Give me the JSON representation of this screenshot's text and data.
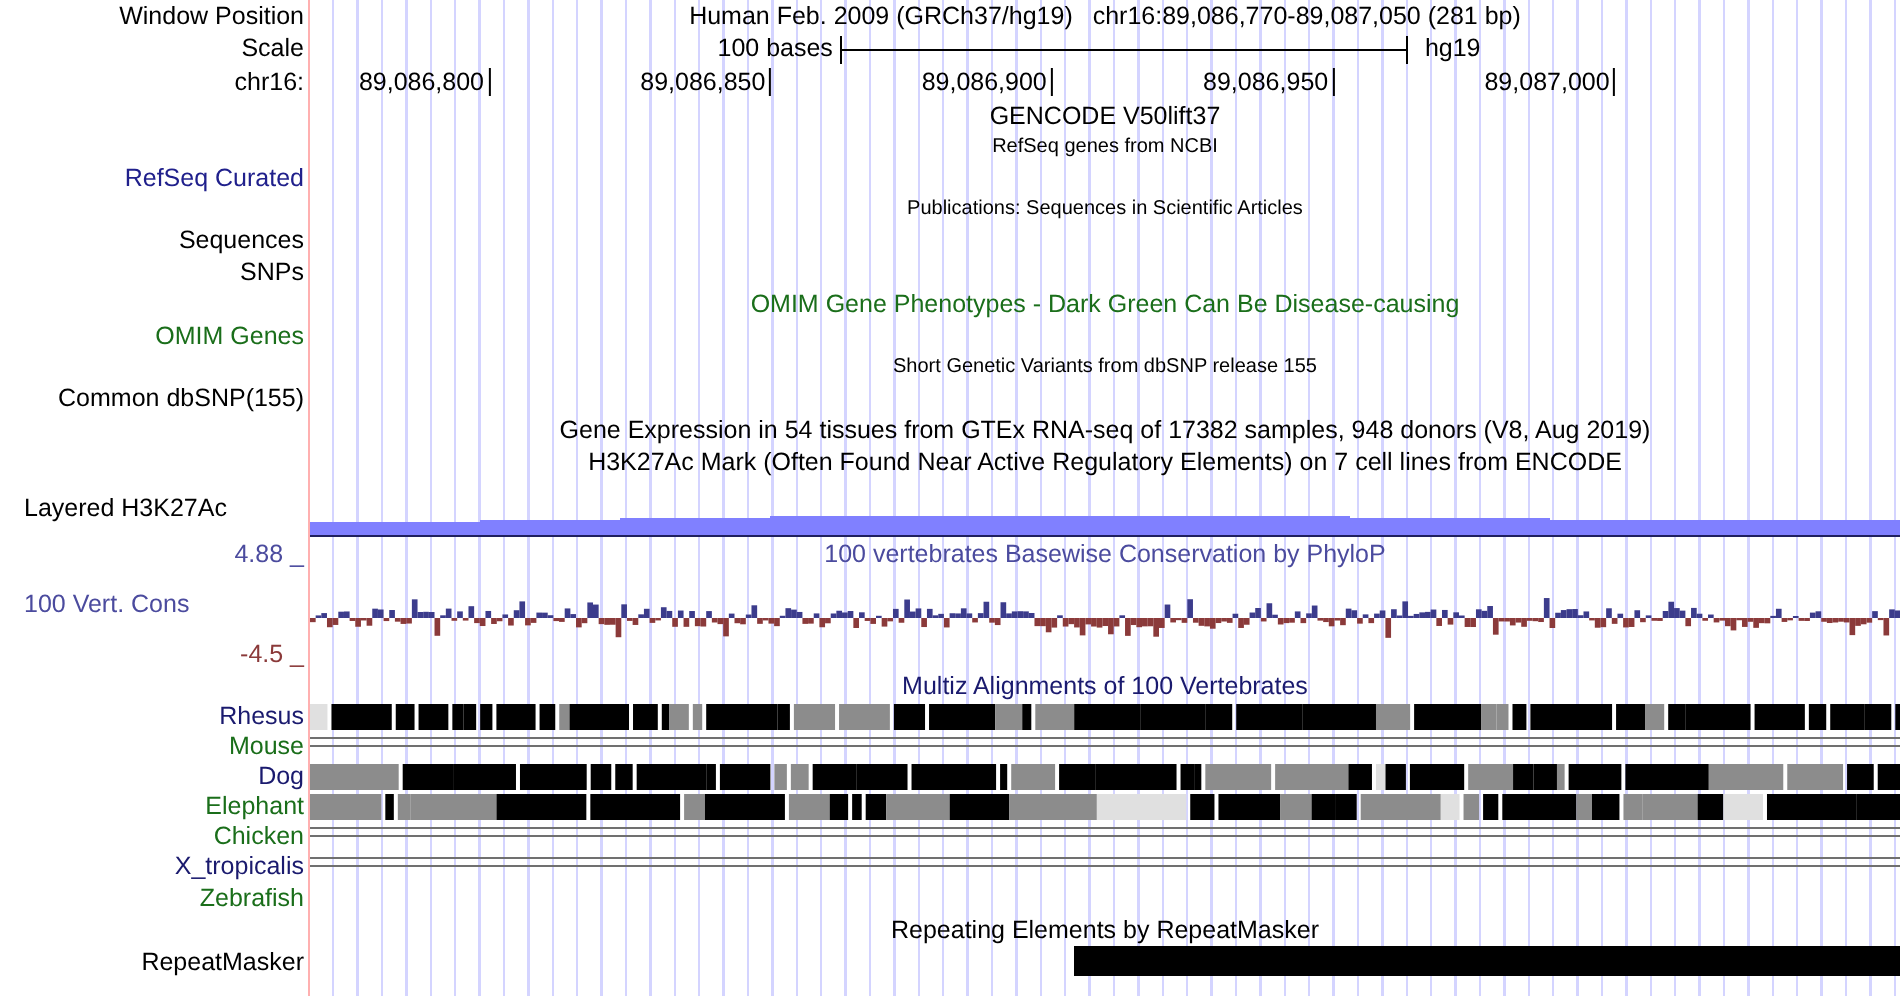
{
  "header": {
    "window_position_label": "Window Position",
    "assembly_title": "Human Feb. 2009 (GRCh37/hg19)",
    "position": "chr16:89,086,770-89,087,050 (281 bp)",
    "scale_label": "Scale",
    "scale_text": "100 bases",
    "scale_assembly": "hg19",
    "chrom_label": "chr16:",
    "ruler_ticks": [
      "89,086,800",
      "89,086,850",
      "89,086,900",
      "89,086,950",
      "89,087,000"
    ]
  },
  "rows": [
    {
      "kind": "title",
      "text": "GENCODE V50lift37"
    },
    {
      "kind": "subtitle",
      "text": "RefSeq genes from NCBI"
    },
    {
      "kind": "empty",
      "label": "RefSeq Curated",
      "color": "#20208c"
    },
    {
      "kind": "subtitle",
      "text": "Publications: Sequences in Scientific Articles"
    },
    {
      "kind": "empty",
      "label": "Sequences"
    },
    {
      "kind": "empty",
      "label": "SNPs"
    },
    {
      "kind": "title",
      "text": "OMIM Gene Phenotypes - Dark Green Can Be Disease-causing",
      "color": "#1a6e1a"
    },
    {
      "kind": "empty",
      "label": "OMIM Genes",
      "color": "#1a6e1a"
    },
    {
      "kind": "subtitle",
      "text": "Short Genetic Variants from dbSNP release 155"
    },
    {
      "kind": "empty",
      "label": "Common dbSNP(155)"
    },
    {
      "kind": "title",
      "text": "Gene Expression in 54 tissues from GTEx RNA-seq of 17382 samples, 948 donors (V8, Aug 2019)"
    },
    {
      "kind": "title",
      "text": "H3K27Ac Mark (Often Found Near Active Regulatory Elements) on 7 cell lines from ENCODE"
    },
    {
      "kind": "layered",
      "label": "Layered H3K27Ac"
    },
    {
      "kind": "title",
      "label": "4.88 _",
      "text": "100 vertebrates Basewise Conservation by PhyloP",
      "color": "#4b4b9e"
    },
    {
      "kind": "phylop",
      "label": "100 Vert. Cons",
      "color": "#4b4b9e"
    },
    {
      "kind": "empty",
      "label": "-4.5 _",
      "color": "#8b3a3a"
    },
    {
      "kind": "title",
      "text": "Multiz Alignments of 100 Vertebrates",
      "color": "#1a1a6e"
    },
    {
      "kind": "alignment",
      "label": "Rhesus",
      "color": "#1a1a6e"
    },
    {
      "kind": "lines",
      "label": "Mouse",
      "color": "#1a6e1a"
    },
    {
      "kind": "alignment",
      "label": "Dog",
      "color": "#1a1a6e"
    },
    {
      "kind": "alignment",
      "label": "Elephant",
      "color": "#1a6e1a"
    },
    {
      "kind": "lines",
      "label": "Chicken",
      "color": "#1a6e1a"
    },
    {
      "kind": "lines",
      "label": "X_tropicalis",
      "color": "#1a1a6e"
    },
    {
      "kind": "empty",
      "label": "Zebrafish",
      "color": "#1a6e1a"
    },
    {
      "kind": "title",
      "text": "Repeating Elements by RepeatMasker"
    },
    {
      "kind": "repeat",
      "label": "RepeatMasker"
    }
  ]
}
